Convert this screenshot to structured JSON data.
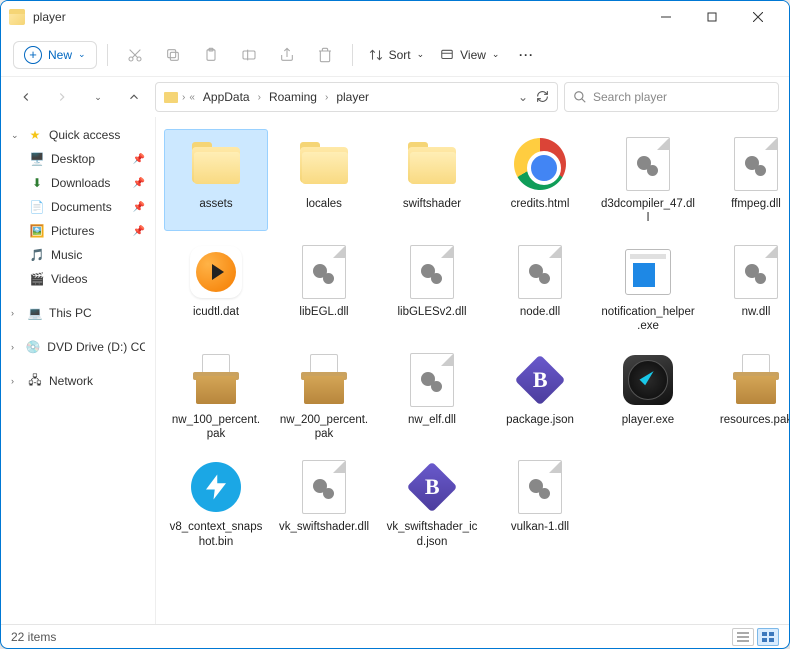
{
  "window": {
    "title": "player"
  },
  "toolbar": {
    "new_label": "New",
    "sort_label": "Sort",
    "view_label": "View"
  },
  "breadcrumb": {
    "items": [
      "AppData",
      "Roaming",
      "player"
    ]
  },
  "search": {
    "placeholder": "Search player"
  },
  "sidebar": {
    "quick_access": "Quick access",
    "items": [
      "Desktop",
      "Downloads",
      "Documents",
      "Pictures",
      "Music",
      "Videos"
    ],
    "this_pc": "This PC",
    "dvd": "DVD Drive (D:) CCCC",
    "network": "Network"
  },
  "files": [
    {
      "name": "assets",
      "type": "folder",
      "selected": true
    },
    {
      "name": "locales",
      "type": "folder"
    },
    {
      "name": "swiftshader",
      "type": "folder"
    },
    {
      "name": "credits.html",
      "type": "chrome"
    },
    {
      "name": "d3dcompiler_47.dll",
      "type": "dll"
    },
    {
      "name": "ffmpeg.dll",
      "type": "dll"
    },
    {
      "name": "icudtl.dat",
      "type": "player"
    },
    {
      "name": "libEGL.dll",
      "type": "dll"
    },
    {
      "name": "libGLESv2.dll",
      "type": "dll"
    },
    {
      "name": "node.dll",
      "type": "dll"
    },
    {
      "name": "notification_helper.exe",
      "type": "helper"
    },
    {
      "name": "nw.dll",
      "type": "dll"
    },
    {
      "name": "nw_100_percent.pak",
      "type": "pak"
    },
    {
      "name": "nw_200_percent.pak",
      "type": "pak"
    },
    {
      "name": "nw_elf.dll",
      "type": "dll"
    },
    {
      "name": "package.json",
      "type": "json"
    },
    {
      "name": "player.exe",
      "type": "compass"
    },
    {
      "name": "resources.pak",
      "type": "pak"
    },
    {
      "name": "v8_context_snapshot.bin",
      "type": "daemon"
    },
    {
      "name": "vk_swiftshader.dll",
      "type": "dll"
    },
    {
      "name": "vk_swiftshader_icd.json",
      "type": "json"
    },
    {
      "name": "vulkan-1.dll",
      "type": "dll"
    }
  ],
  "status": {
    "count": "22 items"
  }
}
